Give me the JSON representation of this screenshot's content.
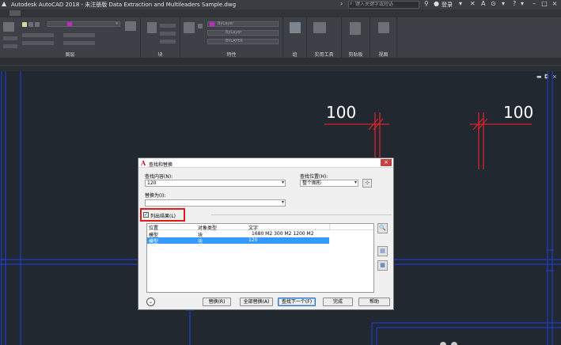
{
  "app": {
    "title": "Autodesk AutoCAD 2018 - 未注册版    Data Extraction and Multileaders Sample.dwg",
    "search_placeholder": "键入关键字或短语",
    "login_label": "登录"
  },
  "ribbon": {
    "layer_panel_label": "图层",
    "block_panel_label": "块",
    "properties_panel_label": "特性",
    "group_panel_label": "组",
    "utilities_panel_label": "实用工具",
    "clipboard_panel_label": "剪贴板",
    "view_panel_label": "视图",
    "bylayer_color": "ByLayer",
    "bylayer_linetype": "ByLayer",
    "bylayer_lineweight": "BYLAYER"
  },
  "drawing": {
    "dim_left": "100",
    "dim_right": "100",
    "colors": {
      "background": "#212830",
      "frame": "#1f3cc8",
      "dim_mark": "#d8232a"
    }
  },
  "dialog": {
    "title": "查找和替换",
    "find_label": "查找内容(N):",
    "find_value": "120",
    "replace_label": "替换为(I):",
    "replace_value": "",
    "search_in_label": "查找位置(H):",
    "search_in_value": "整个图形",
    "list_results_label": "列出结果(L)",
    "list_results_checked": "✓",
    "columns": [
      "位置",
      "对象类型",
      "文字"
    ],
    "rows": [
      {
        "location": "模型",
        "type": "块",
        "text": "1680 M2     300 M2 1200 M2"
      },
      {
        "location": "模型",
        "type": "块",
        "text": "120"
      }
    ],
    "buttons": {
      "replace": "替换(R)",
      "replace_all": "全部替换(A)",
      "find_next": "查找下一个(F)",
      "done": "完成",
      "help": "帮助"
    }
  }
}
